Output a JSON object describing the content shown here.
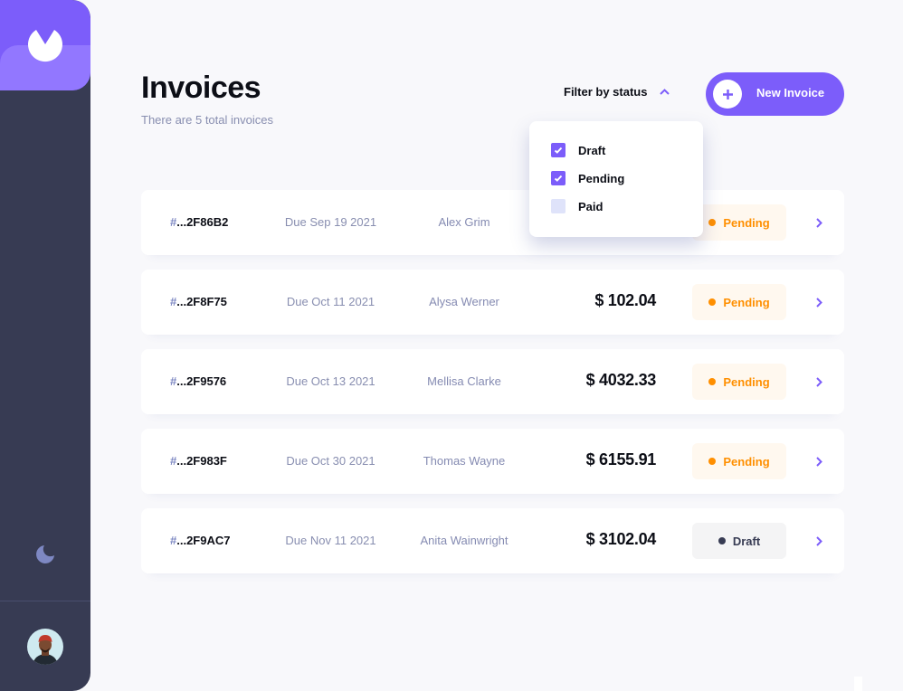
{
  "sidebar": {
    "logo_icon": "app-logo-icon",
    "theme_icon": "moon-icon",
    "avatar_icon": "user-avatar"
  },
  "header": {
    "title": "Invoices",
    "subtitle": "There are 5 total invoices",
    "filter_label": "Filter by status",
    "new_invoice_label": "New Invoice"
  },
  "filter": {
    "options": [
      {
        "label": "Draft",
        "checked": true
      },
      {
        "label": "Pending",
        "checked": true
      },
      {
        "label": "Paid",
        "checked": false
      }
    ]
  },
  "invoices": [
    {
      "hash": "#",
      "id": "...2F86B2",
      "due": "Due Sep 19 2021",
      "client": "Alex Grim",
      "total": "",
      "status": "Pending"
    },
    {
      "hash": "#",
      "id": "...2F8F75",
      "due": "Due Oct 11 2021",
      "client": "Alysa Werner",
      "total": "$ 102.04",
      "status": "Pending"
    },
    {
      "hash": "#",
      "id": "...2F9576",
      "due": "Due Oct 13 2021",
      "client": "Mellisa Clarke",
      "total": "$ 4032.33",
      "status": "Pending"
    },
    {
      "hash": "#",
      "id": "...2F983F",
      "due": "Due Oct 30 2021",
      "client": "Thomas Wayne",
      "total": "$ 6155.91",
      "status": "Pending"
    },
    {
      "hash": "#",
      "id": "...2F9AC7",
      "due": "Due Nov 11 2021",
      "client": "Anita Wainwright",
      "total": "$ 3102.04",
      "status": "Draft"
    }
  ],
  "colors": {
    "accent": "#7c5dfa",
    "accent_light": "#9277ff",
    "sidebar": "#373b53",
    "pending": "#ff8f00",
    "draft": "#373b53",
    "background": "#f8f8fb"
  }
}
